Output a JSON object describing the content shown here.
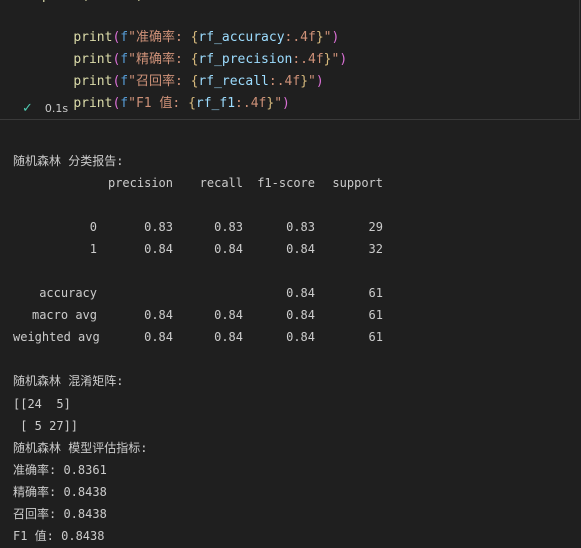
{
  "cell": {
    "code_lines": [
      {
        "label": "准确率: ",
        "var": "rf_accuracy",
        "fmt": ":.4f"
      },
      {
        "label": "精确率: ",
        "var": "rf_precision",
        "fmt": ":.4f"
      },
      {
        "label": "召回率: ",
        "var": "rf_recall",
        "fmt": ":.4f"
      },
      {
        "label": "F1 值: ",
        "var": "rf_f1",
        "fmt": ":.4f"
      }
    ],
    "exec_time": "0.1s"
  },
  "output": {
    "report_title": "随机森林 分类报告:",
    "report": {
      "headers": [
        "precision",
        "recall",
        "f1-score",
        "support"
      ],
      "rows": [
        {
          "label": "0",
          "precision": "0.83",
          "recall": "0.83",
          "f1": "0.83",
          "support": "29"
        },
        {
          "label": "1",
          "precision": "0.84",
          "recall": "0.84",
          "f1": "0.84",
          "support": "32"
        },
        {
          "label": "accuracy",
          "precision": "",
          "recall": "",
          "f1": "0.84",
          "support": "61"
        },
        {
          "label": "macro avg",
          "precision": "0.84",
          "recall": "0.84",
          "f1": "0.84",
          "support": "61"
        },
        {
          "label": "weighted avg",
          "precision": "0.84",
          "recall": "0.84",
          "f1": "0.84",
          "support": "61"
        }
      ]
    },
    "confusion_title": "随机森林 混淆矩阵:",
    "confusion_lines": [
      "[[24  5]",
      " [ 5 27]]"
    ],
    "metrics_title": "随机森林 模型评估指标:",
    "metrics": [
      "准确率: 0.8361",
      "精确率: 0.8438",
      "召回率: 0.8438",
      "F1 值: 0.8438"
    ]
  }
}
